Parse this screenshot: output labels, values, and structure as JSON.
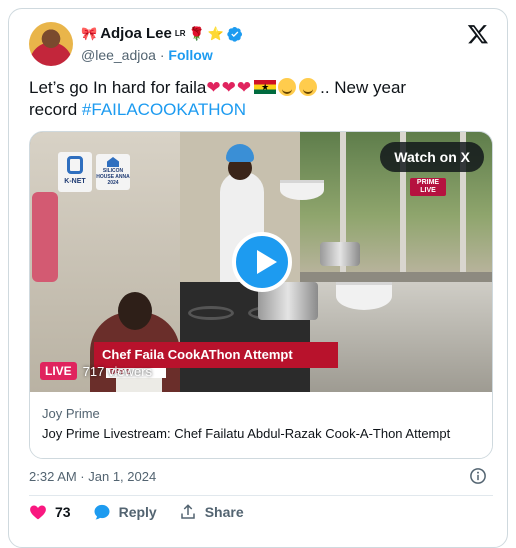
{
  "author": {
    "name": "Adjoa Lee",
    "name_suffix": "LR",
    "handle": "@lee_adjoa",
    "separator": "·",
    "follow_label": "Follow"
  },
  "tweet": {
    "text_part1": "Let’s go In hard for faila",
    "text_part2": ".. New year",
    "text_part3": "record",
    "hashtag": "#FAILACOOKATHON"
  },
  "media": {
    "watch_label": "Watch on X",
    "overlay_brand_1": "K-NET",
    "overlay_brand_2": "SILICON HOUSE ANNA 2024",
    "prime_badge_line1": "PRIME",
    "prime_badge_line2": "LIVE",
    "lower_third_text": "Chef Faila  CookAThon Attempt",
    "lower_third_day": "DAY 1",
    "live_label": "LIVE",
    "viewers": "717 viewers",
    "source": "Joy Prime",
    "title": "Joy Prime Livestream: Chef Failatu Abdul-Razak Cook-A-Thon Attempt"
  },
  "meta": {
    "timestamp": "2:32 AM · Jan 1, 2024"
  },
  "actions": {
    "like_count": "73",
    "reply_label": "Reply",
    "share_label": "Share"
  },
  "colors": {
    "accent": "#1d9bf0",
    "like": "#f91880",
    "live": "#e0245e"
  }
}
